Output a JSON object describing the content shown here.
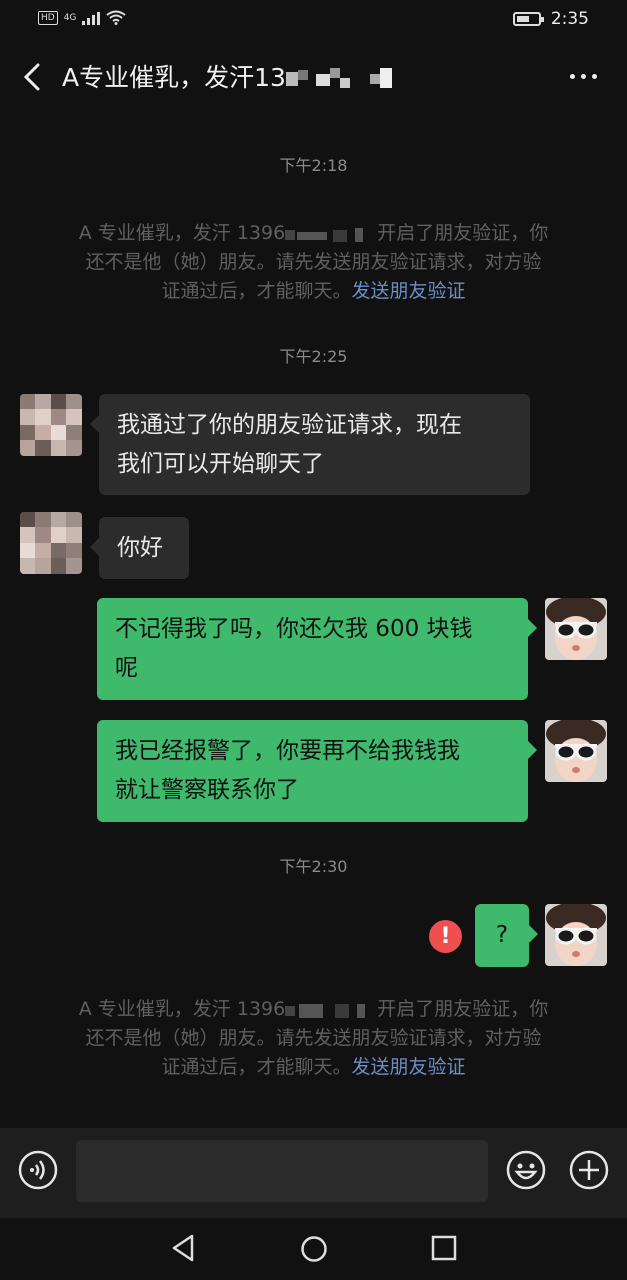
{
  "status_bar": {
    "hd": "HD",
    "network": "4G",
    "time": "2:35",
    "battery_level": 0.6
  },
  "header": {
    "title": "A专业催乳，发汗13",
    "more_icon": "more-dots-icon",
    "back_icon": "back-arrow-icon"
  },
  "messages": {
    "t1": "下午2:18",
    "sys1": {
      "part1": "A 专业催乳，发汗 1396",
      "part2": "开启了朋友验证，你",
      "line2": "还不是他（她）朋友。请先发送朋友验证请求，对方验",
      "line3": "证通过后，才能聊天。",
      "link": "发送朋友验证"
    },
    "t2": "下午2:25",
    "in1": {
      "line1": "我通过了你的朋友验证请求，现在",
      "line2": "我们可以开始聊天了"
    },
    "in2": "你好",
    "out1": {
      "line1": "不记得我了吗，你还欠我 600 块钱",
      "line2": "呢"
    },
    "out2": {
      "line1": "我已经报警了，你要再不给我钱我",
      "line2": "就让警察联系你了"
    },
    "t3": "下午2:30",
    "out3": "?",
    "out3_error": "!",
    "sys2": {
      "part1": "A 专业催乳，发汗 1396",
      "part2": "开启了朋友验证，你",
      "line2": "还不是他（她）朋友。请先发送朋友验证请求，对方验",
      "line3": "证通过后，才能聊天。",
      "link": "发送朋友验证"
    }
  },
  "input_bar": {
    "voice_icon": "voice-icon",
    "emoji_icon": "emoji-icon",
    "plus_icon": "plus-icon",
    "text": ""
  },
  "nav": {
    "back": "nav-back-icon",
    "home": "nav-home-icon",
    "recents": "nav-recents-icon"
  },
  "colors": {
    "bg": "#111111",
    "out_bubble": "#3fb96b",
    "in_bubble": "#2c2c2c",
    "link": "#6b8ec6",
    "error": "#f04f4f"
  }
}
